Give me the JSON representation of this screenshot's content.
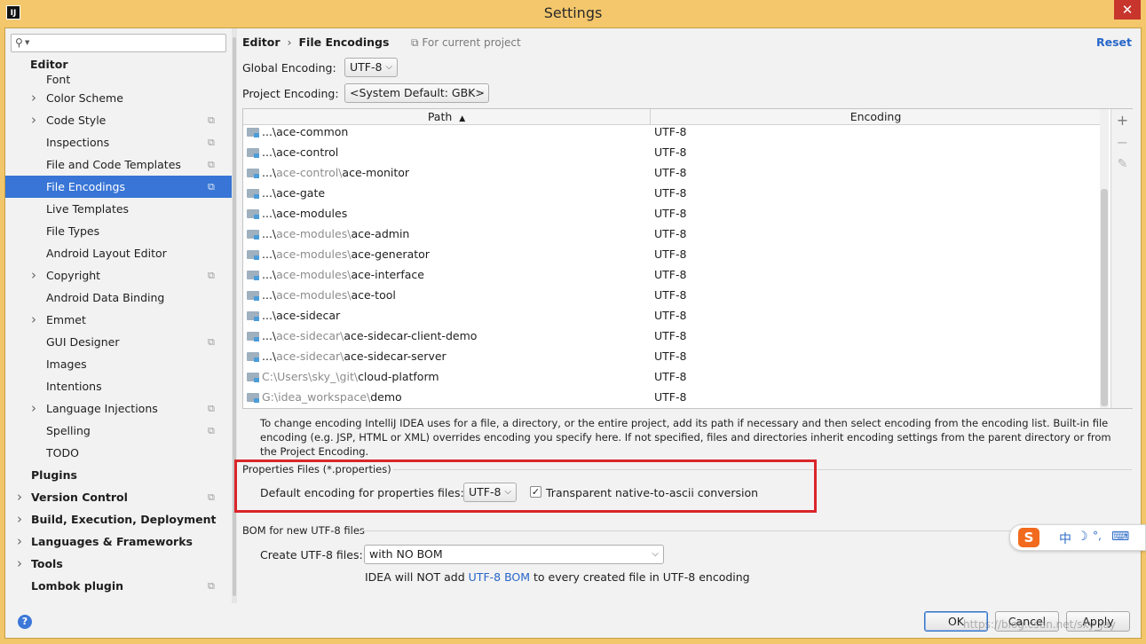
{
  "window": {
    "title": "Settings",
    "app_icon": "IJ",
    "close_glyph": "✕"
  },
  "sidebar": {
    "search": {
      "icon": "search-icon",
      "value": "",
      "placeholder": ""
    },
    "items": [
      {
        "label": "Editor",
        "bold": true,
        "arrow": false,
        "copy": false
      },
      {
        "label": "Font",
        "arrow": false,
        "copy": false
      },
      {
        "label": "Color Scheme",
        "arrow": true,
        "copy": false
      },
      {
        "label": "Code Style",
        "arrow": true,
        "copy": true
      },
      {
        "label": "Inspections",
        "arrow": false,
        "copy": true
      },
      {
        "label": "File and Code Templates",
        "arrow": false,
        "copy": true
      },
      {
        "label": "File Encodings",
        "arrow": false,
        "copy": true,
        "selected": true
      },
      {
        "label": "Live Templates",
        "arrow": false,
        "copy": false
      },
      {
        "label": "File Types",
        "arrow": false,
        "copy": false
      },
      {
        "label": "Android Layout Editor",
        "arrow": false,
        "copy": false
      },
      {
        "label": "Copyright",
        "arrow": true,
        "copy": true
      },
      {
        "label": "Android Data Binding",
        "arrow": false,
        "copy": false
      },
      {
        "label": "Emmet",
        "arrow": true,
        "copy": false
      },
      {
        "label": "GUI Designer",
        "arrow": false,
        "copy": true
      },
      {
        "label": "Images",
        "arrow": false,
        "copy": false
      },
      {
        "label": "Intentions",
        "arrow": false,
        "copy": false
      },
      {
        "label": "Language Injections",
        "arrow": true,
        "copy": true
      },
      {
        "label": "Spelling",
        "arrow": false,
        "copy": true
      },
      {
        "label": "TODO",
        "arrow": false,
        "copy": false
      },
      {
        "label": "Plugins",
        "bold": true,
        "top": true,
        "arrow": false,
        "copy": false
      },
      {
        "label": "Version Control",
        "bold": true,
        "top": true,
        "arrow": true,
        "copy": true
      },
      {
        "label": "Build, Execution, Deployment",
        "bold": true,
        "top": true,
        "arrow": true,
        "copy": false
      },
      {
        "label": "Languages & Frameworks",
        "bold": true,
        "top": true,
        "arrow": true,
        "copy": false
      },
      {
        "label": "Tools",
        "bold": true,
        "top": true,
        "arrow": true,
        "copy": false
      },
      {
        "label": "Lombok plugin",
        "bold": true,
        "top": true,
        "arrow": false,
        "copy": true
      }
    ]
  },
  "header": {
    "crumb_parent": "Editor",
    "crumb_sep": "›",
    "crumb_current": "File Encodings",
    "scope": "For current project",
    "reset": "Reset"
  },
  "global_encoding": {
    "label": "Global Encoding:",
    "value": "UTF-8"
  },
  "project_encoding": {
    "label": "Project Encoding:",
    "value": "<System Default: GBK>"
  },
  "table": {
    "columns": [
      "Path",
      "Encoding"
    ],
    "sort_glyph": "▲",
    "rows": [
      {
        "prefix": "...\\",
        "dim": "",
        "name": "ace-common",
        "encoding": "UTF-8"
      },
      {
        "prefix": "...\\",
        "dim": "",
        "name": "ace-control",
        "encoding": "UTF-8"
      },
      {
        "prefix": "...\\",
        "dim": "ace-control\\",
        "name": "ace-monitor",
        "encoding": "UTF-8"
      },
      {
        "prefix": "...\\",
        "dim": "",
        "name": "ace-gate",
        "encoding": "UTF-8"
      },
      {
        "prefix": "...\\",
        "dim": "",
        "name": "ace-modules",
        "encoding": "UTF-8"
      },
      {
        "prefix": "...\\",
        "dim": "ace-modules\\",
        "name": "ace-admin",
        "encoding": "UTF-8"
      },
      {
        "prefix": "...\\",
        "dim": "ace-modules\\",
        "name": "ace-generator",
        "encoding": "UTF-8"
      },
      {
        "prefix": "...\\",
        "dim": "ace-modules\\",
        "name": "ace-interface",
        "encoding": "UTF-8"
      },
      {
        "prefix": "...\\",
        "dim": "ace-modules\\",
        "name": "ace-tool",
        "encoding": "UTF-8"
      },
      {
        "prefix": "...\\",
        "dim": "",
        "name": "ace-sidecar",
        "encoding": "UTF-8"
      },
      {
        "prefix": "...\\",
        "dim": "ace-sidecar\\",
        "name": "ace-sidecar-client-demo",
        "encoding": "UTF-8"
      },
      {
        "prefix": "...\\",
        "dim": "ace-sidecar\\",
        "name": "ace-sidecar-server",
        "encoding": "UTF-8"
      },
      {
        "prefix": "",
        "dim": "C:\\Users\\sky_\\git\\",
        "name": "cloud-platform",
        "encoding": "UTF-8"
      },
      {
        "prefix": "",
        "dim": "G:\\idea_workspace\\",
        "name": "demo",
        "encoding": "UTF-8"
      }
    ],
    "tools": {
      "add": "+",
      "remove": "−",
      "edit": "✎"
    }
  },
  "help_text": "To change encoding IntelliJ IDEA uses for a file, a directory, or the entire project, add its path if necessary and then select encoding from the encoding list. Built-in file encoding (e.g. JSP, HTML or XML) overrides encoding you specify here. If not specified, files and directories inherit encoding settings from the parent directory or from the Project Encoding.",
  "properties": {
    "section": "Properties Files (*.properties)",
    "default_label": "Default encoding for properties files:",
    "default_value": "UTF-8",
    "native_ascii_label": "Transparent native-to-ascii conversion",
    "native_ascii_checked": true,
    "check_glyph": "✓"
  },
  "bom": {
    "section": "BOM for new UTF-8 files",
    "create_label": "Create UTF-8 files:",
    "create_value": "with NO BOM",
    "note_before": "IDEA will NOT add ",
    "note_link": "UTF-8 BOM",
    "note_after": " to every created file in UTF-8 encoding"
  },
  "footer": {
    "help": "?",
    "ok": "OK",
    "cancel": "Cancel",
    "apply": "Apply"
  },
  "ime": {
    "logo": "S",
    "lang": "中",
    "moon": "☽",
    "punct": "°,",
    "keyboard": "⌨"
  },
  "watermark": "https://blog.csdn.net/sky_jay",
  "colors": {
    "accent": "#3875d6",
    "link": "#2766c9",
    "highlight_box": "#d9252a",
    "titlebar": "#f4c76c"
  }
}
